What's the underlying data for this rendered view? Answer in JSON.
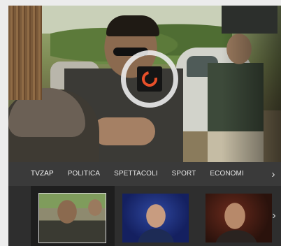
{
  "player": {
    "state": "loading",
    "spinner_color": "#e8502a"
  },
  "tabs": [
    {
      "label": "TVZAP",
      "active": true
    },
    {
      "label": "POLITICA",
      "active": false
    },
    {
      "label": "SPETTACOLI",
      "active": false
    },
    {
      "label": "SPORT",
      "active": false
    },
    {
      "label": "ECONOMI",
      "active": false
    }
  ],
  "tabs_next_icon": "chevron-right-icon",
  "thumbnails": [
    {
      "name": "thumbnail-1",
      "selected": true
    },
    {
      "name": "thumbnail-2",
      "selected": false
    },
    {
      "name": "thumbnail-3",
      "selected": false
    }
  ],
  "thumbnails_next_icon": "chevron-right-icon"
}
